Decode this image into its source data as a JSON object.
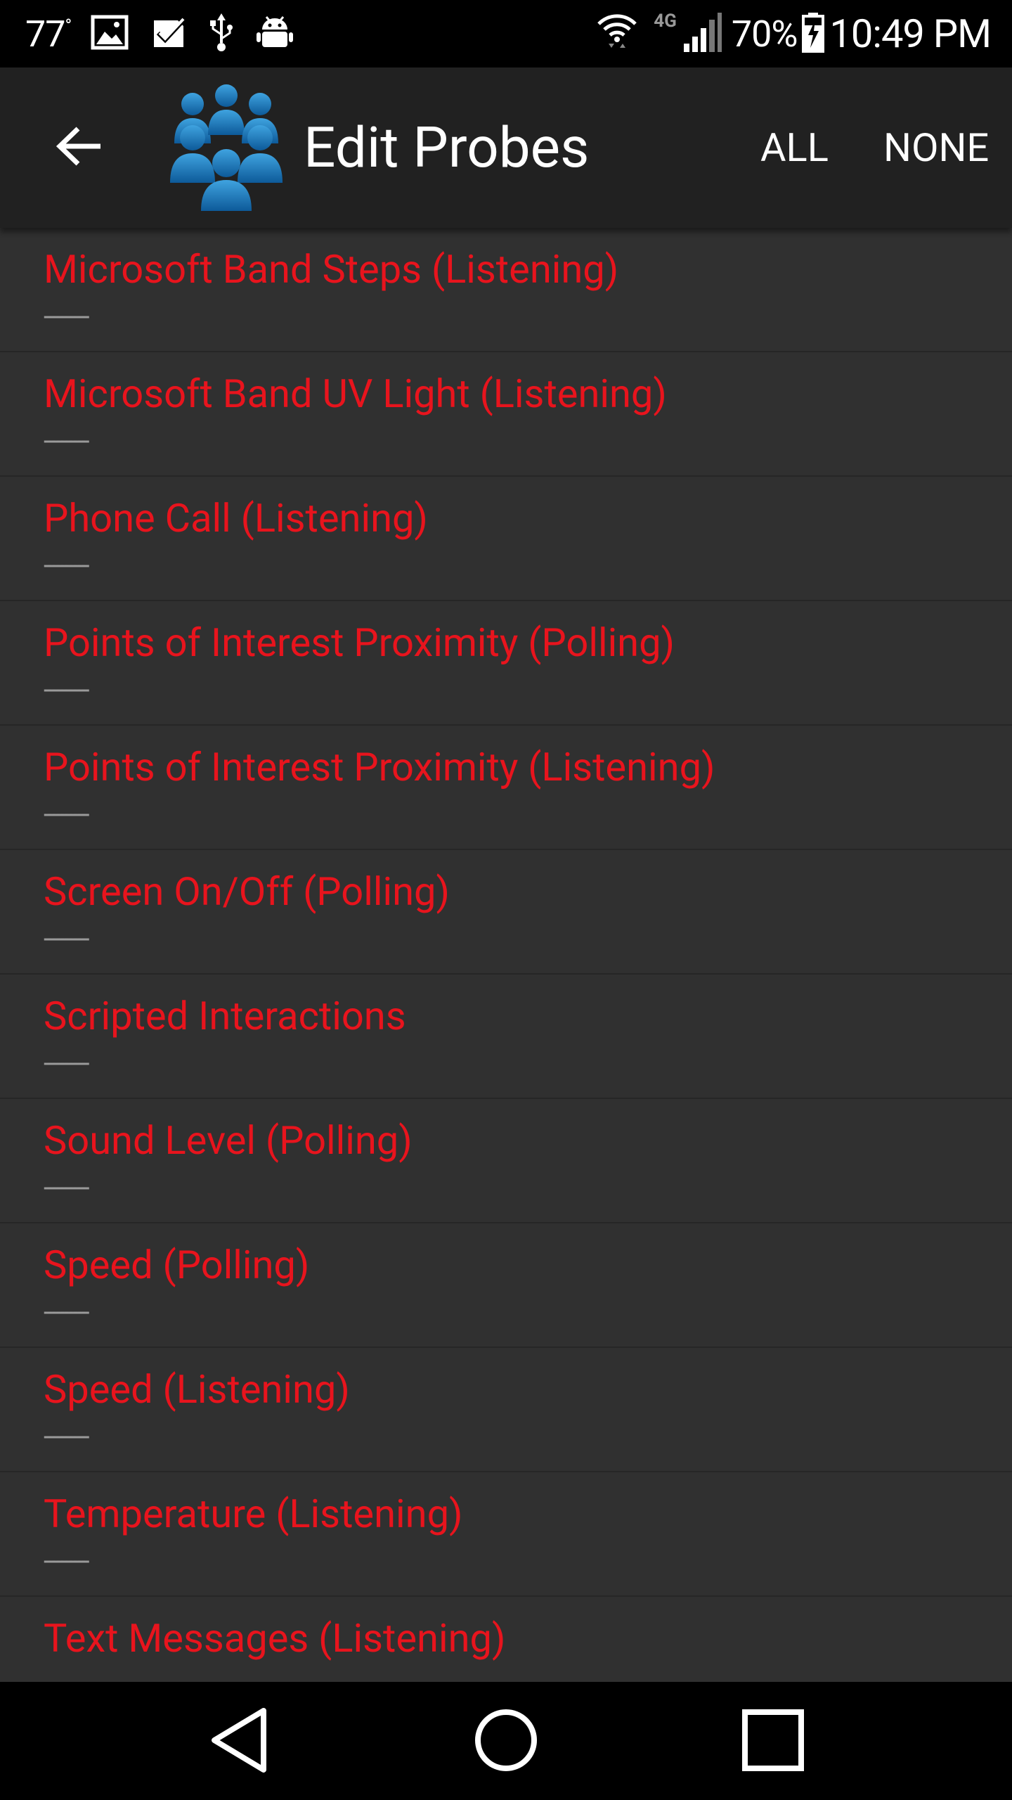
{
  "status_bar": {
    "temperature": "77",
    "degree": "°",
    "network": "4G",
    "battery_percent": "70%",
    "time": "10:49 PM"
  },
  "app_bar": {
    "title": "Edit Probes",
    "actions": {
      "all": "ALL",
      "none": "NONE"
    }
  },
  "probes": [
    {
      "title": "Microsoft Band Steps (Listening)",
      "subtitle": "----------"
    },
    {
      "title": "Microsoft Band UV Light (Listening)",
      "subtitle": "----------"
    },
    {
      "title": "Phone Call (Listening)",
      "subtitle": "----------"
    },
    {
      "title": "Points of Interest Proximity (Polling)",
      "subtitle": "----------"
    },
    {
      "title": "Points of Interest Proximity (Listening)",
      "subtitle": "----------"
    },
    {
      "title": "Screen On/Off (Polling)",
      "subtitle": "----------"
    },
    {
      "title": "Scripted Interactions",
      "subtitle": "----------"
    },
    {
      "title": "Sound Level (Polling)",
      "subtitle": "----------"
    },
    {
      "title": "Speed (Polling)",
      "subtitle": "----------"
    },
    {
      "title": "Speed (Listening)",
      "subtitle": "----------"
    },
    {
      "title": "Temperature (Listening)",
      "subtitle": "----------"
    },
    {
      "title": "Text Messages (Listening)",
      "subtitle": "----------"
    }
  ],
  "colors": {
    "probe_title": "#e8141d",
    "app_bar": "#212121",
    "list_background": "#303030"
  },
  "icons": {
    "status_left": [
      "image-icon",
      "checkmark-clipboard-icon",
      "usb-icon",
      "android-debug-icon"
    ],
    "status_right": [
      "wifi-icon",
      "network-4g-icon",
      "cell-signal-icon",
      "battery-charging-icon"
    ],
    "app_bar": [
      "back-arrow-icon",
      "people-group-logo-icon"
    ],
    "nav_bar": [
      "nav-back-icon",
      "nav-home-icon",
      "nav-recents-icon"
    ]
  }
}
